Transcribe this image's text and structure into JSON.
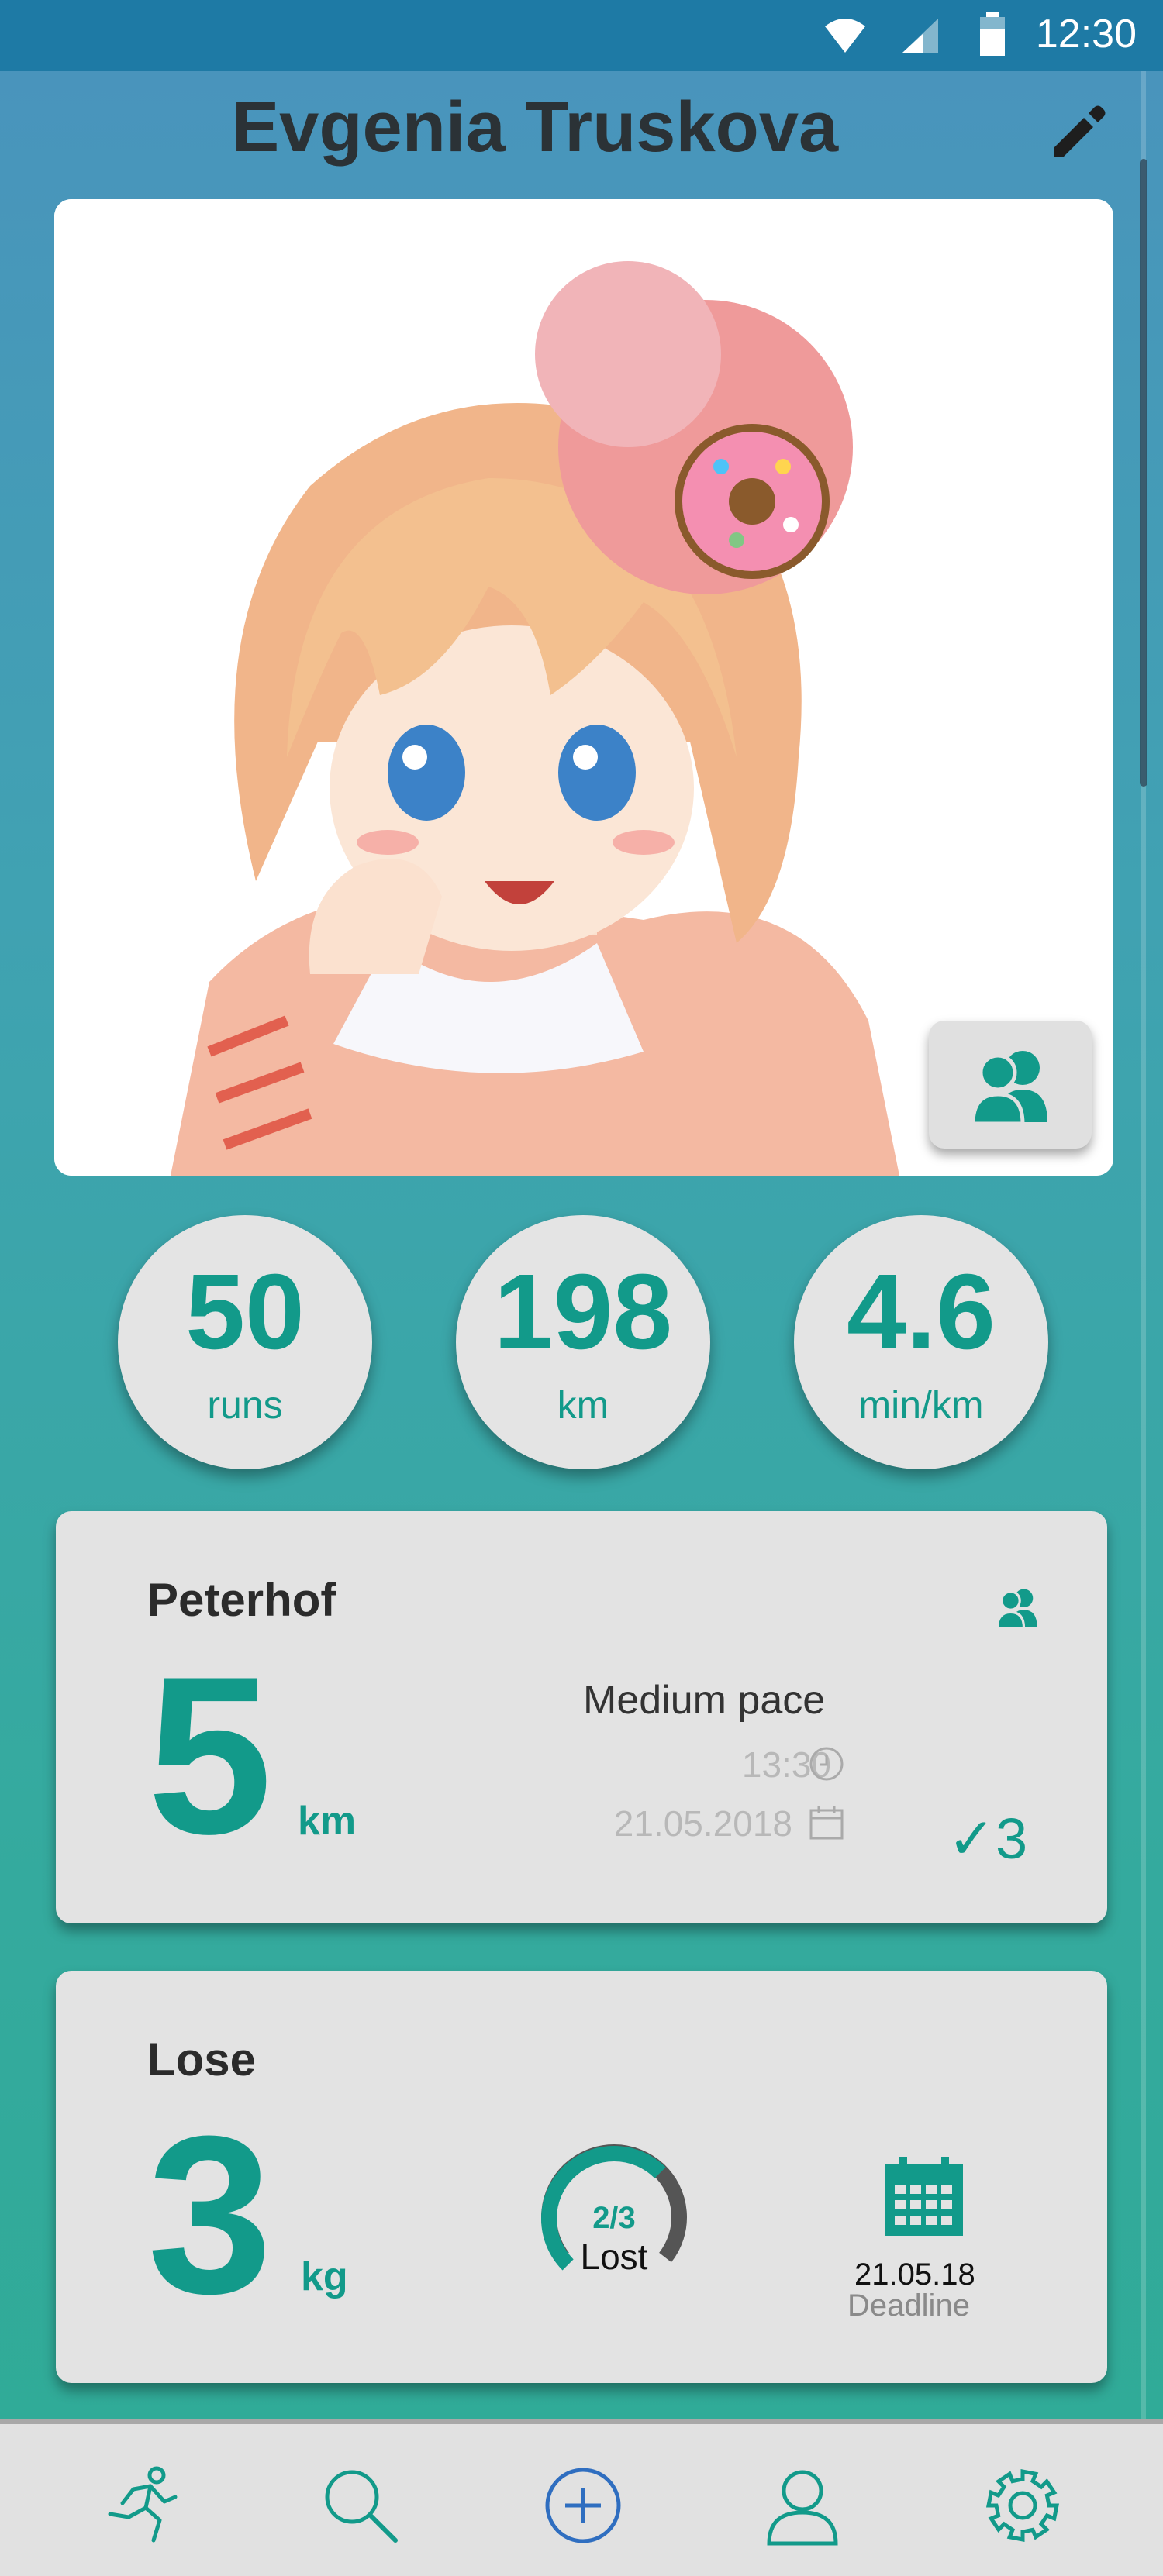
{
  "status_bar": {
    "time": "12:30"
  },
  "profile": {
    "name": "Evgenia Truskova"
  },
  "stats": [
    {
      "value": "50",
      "unit": "runs"
    },
    {
      "value": "198",
      "unit": "km"
    },
    {
      "value": "4.6",
      "unit": "min/km"
    }
  ],
  "run_card": {
    "location": "Peterhof",
    "distance": "5",
    "distance_unit": "km",
    "pace": "Medium pace",
    "time": "13:30",
    "date": "21.05.2018",
    "completed_count": "✓3"
  },
  "goal_card": {
    "title": "Lose",
    "amount": "3",
    "amount_unit": "kg",
    "progress_text": "2/3",
    "progress_fraction": 0.667,
    "progress_label": "Lost",
    "deadline_date": "21.05.18",
    "deadline_label": "Deadline"
  },
  "colors": {
    "accent": "#129a8a",
    "statusbar": "#1e7aa5",
    "card": "#e3e3e3"
  },
  "icons": {
    "edit": "pencil-icon",
    "friends": "group-icon",
    "nav": [
      "runner-icon",
      "search-icon",
      "add-circle-icon",
      "profile-icon",
      "gear-icon"
    ]
  }
}
